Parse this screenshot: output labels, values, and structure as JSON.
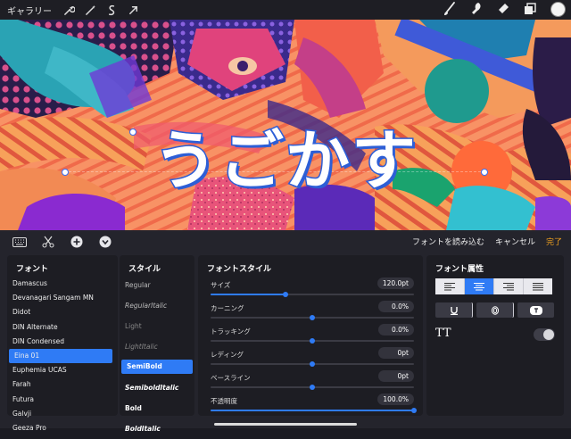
{
  "toolbar": {
    "gallery": "ギャラリー",
    "left_icons": [
      "wrench-icon",
      "magic-wand-icon",
      "selection-icon",
      "transform-icon"
    ],
    "right_icons": [
      "brush-icon",
      "smudge-icon",
      "eraser-icon",
      "layers-icon",
      "color-icon"
    ],
    "current_color": "#f4f4f4"
  },
  "canvas": {
    "text": "うごかす",
    "text_color": "#ffffff",
    "outline_color": "#2e5fd6"
  },
  "editor_bar": {
    "icons": [
      "keyboard-icon",
      "cut-icon",
      "add-icon",
      "more-icon"
    ],
    "import_font": "フォントを読み込む",
    "cancel": "キャンセル",
    "done": "完了"
  },
  "fonts": {
    "title": "フォント",
    "items": [
      "Damascus",
      "Devanagari Sangam MN",
      "Didot",
      "DIN Alternate",
      "DIN Condensed",
      "Eina 01",
      "Euphemia UCAS",
      "Farah",
      "Futura",
      "Galvji",
      "Geeza Pro"
    ],
    "selected": "Eina 01"
  },
  "styles": {
    "title": "スタイル",
    "items": [
      "Regular",
      "RegularItalic",
      "Light",
      "LightItalic",
      "SemiBold",
      "SemiboldItalic",
      "Bold",
      "BoldItalic"
    ],
    "selected": "SemiBold"
  },
  "font_style": {
    "title": "フォントスタイル",
    "rows": [
      {
        "label": "サイズ",
        "value": "120.0pt",
        "level": 0.37
      },
      {
        "label": "カーニング",
        "value": "0.0%",
        "level": 0.5
      },
      {
        "label": "トラッキング",
        "value": "0.0%",
        "level": 0.5
      },
      {
        "label": "レディング",
        "value": "0pt",
        "level": 0.5
      },
      {
        "label": "ベースライン",
        "value": "0pt",
        "level": 0.5
      },
      {
        "label": "不透明度",
        "value": "100.0%",
        "level": 1.0
      }
    ]
  },
  "font_attr": {
    "title": "フォント属性",
    "alignments": [
      "align-left-icon",
      "align-center-icon",
      "align-right-icon",
      "align-justify-icon"
    ],
    "alignment_selected": "align-center-icon",
    "decorations": [
      "underline-icon",
      "outline-icon",
      "text-box-icon"
    ],
    "caps_label": "TT",
    "caps_enabled": false
  },
  "accent": "#2f7bf5"
}
